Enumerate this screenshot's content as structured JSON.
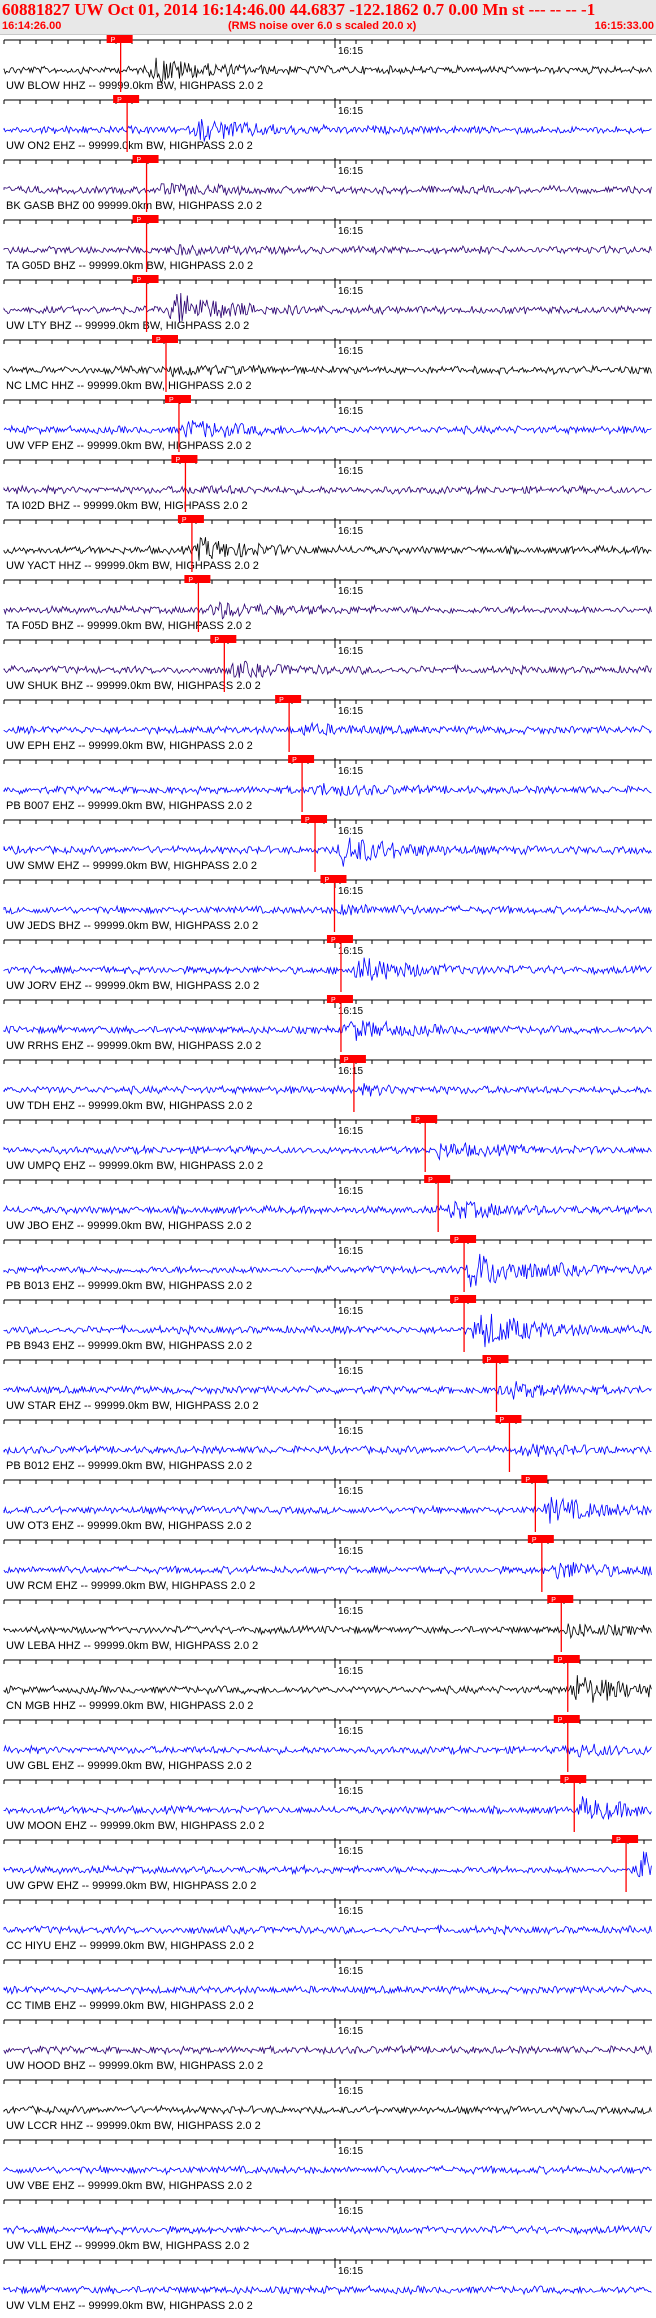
{
  "header": {
    "title": "60881827 UW Oct 01, 2014 16:14:46.00   44.6837 -122.1862  0.7 0.00 Mn st --- -- --  -1",
    "start_time": "16:14:26.00",
    "rms_note": "(RMS noise over 6.0 s scaled 20.0 x)",
    "end_time": "16:15:33.00"
  },
  "colors": {
    "axis": "#000000",
    "trace_blue": "#0000ff",
    "trace_black": "#000000",
    "trace_purple": "#2a0070",
    "pick_marker": "#ff0000",
    "header_text": "#ff0000"
  },
  "minute_tick_label": "16:15",
  "pick_label": "P",
  "stations": [
    {
      "label": "UW BLOW HHZ -- 99999.0km BW, HIGHPASS  2.0  2",
      "color": "black",
      "pick": 0.18,
      "event": 0.23,
      "amp": 0.6
    },
    {
      "label": "UW ON2 EHZ -- 99999.0km BW, HIGHPASS  2.0  2",
      "color": "blue",
      "pick": 0.19,
      "event": 0.3,
      "amp": 0.5
    },
    {
      "label": "BK GASB BHZ 00 99999.0km BW, HIGHPASS  2.0  2",
      "color": "purple",
      "pick": 0.22,
      "event": 0.24,
      "amp": 0.2
    },
    {
      "label": "TA G05D BHZ -- 99999.0km BW, HIGHPASS  2.0  2",
      "color": "purple",
      "pick": 0.22,
      "event": 0.26,
      "amp": 0.15
    },
    {
      "label": "UW LTY BHZ -- 99999.0km BW, HIGHPASS  2.0  2",
      "color": "purple",
      "pick": 0.22,
      "event": 0.26,
      "amp": 0.8
    },
    {
      "label": "NC LMC HHZ -- 99999.0km BW, HIGHPASS  2.0  2",
      "color": "black",
      "pick": 0.25,
      "event": 0.26,
      "amp": 0.2
    },
    {
      "label": "UW VFP EHZ -- 99999.0km BW, HIGHPASS  2.0  2",
      "color": "blue",
      "pick": 0.27,
      "event": 0.28,
      "amp": 0.4
    },
    {
      "label": "TA I02D BHZ -- 99999.0km BW, HIGHPASS  2.0  2",
      "color": "purple",
      "pick": 0.28,
      "event": 0.29,
      "amp": 0.1
    },
    {
      "label": "UW YACT HHZ -- 99999.0km BW, HIGHPASS  2.0  2",
      "color": "black",
      "pick": 0.29,
      "event": 0.3,
      "amp": 0.5
    },
    {
      "label": "TA F05D BHZ -- 99999.0km BW, HIGHPASS  2.0  2",
      "color": "purple",
      "pick": 0.3,
      "event": 0.32,
      "amp": 0.35
    },
    {
      "label": "UW SHUK BHZ -- 99999.0km BW, HIGHPASS  2.0  2",
      "color": "purple",
      "pick": 0.34,
      "event": 0.35,
      "amp": 0.3
    },
    {
      "label": "UW EPH EHZ -- 99999.0km BW, HIGHPASS  2.0  2",
      "color": "blue",
      "pick": 0.44,
      "event": 0.46,
      "amp": 0.2
    },
    {
      "label": "PB B007 EHZ -- 99999.0km BW, HIGHPASS  2.0  2",
      "color": "blue",
      "pick": 0.46,
      "event": 0.48,
      "amp": 0.25
    },
    {
      "label": "UW SMW EHZ -- 99999.0km BW, HIGHPASS  2.0  2",
      "color": "blue",
      "pick": 0.48,
      "event": 0.52,
      "amp": 0.7
    },
    {
      "label": "UW JEDS BHZ -- 99999.0km BW, HIGHPASS  2.0  2",
      "color": "blue",
      "pick": 0.51,
      "event": 0.52,
      "amp": 0.2
    },
    {
      "label": "UW JORV EHZ -- 99999.0km BW, HIGHPASS  2.0  2",
      "color": "blue",
      "pick": 0.52,
      "event": 0.54,
      "amp": 0.6
    },
    {
      "label": "UW RRHS EHZ -- 99999.0km BW, HIGHPASS  2.0  2",
      "color": "blue",
      "pick": 0.52,
      "event": 0.53,
      "amp": 0.45
    },
    {
      "label": "UW TDH EHZ -- 99999.0km BW, HIGHPASS  2.0  2",
      "color": "blue",
      "pick": 0.54,
      "event": 0.55,
      "amp": 0.15
    },
    {
      "label": "UW UMPQ EHZ -- 99999.0km BW, HIGHPASS  2.0  2",
      "color": "blue",
      "pick": 0.65,
      "event": 0.67,
      "amp": 0.3
    },
    {
      "label": "UW JBO EHZ -- 99999.0km BW, HIGHPASS  2.0  2",
      "color": "blue",
      "pick": 0.67,
      "event": 0.69,
      "amp": 0.4
    },
    {
      "label": "PB B013 EHZ -- 99999.0km BW, HIGHPASS  2.0  2",
      "color": "blue",
      "pick": 0.71,
      "event": 0.72,
      "amp": 0.9
    },
    {
      "label": "PB B943 EHZ -- 99999.0km BW, HIGHPASS  2.0  2",
      "color": "blue",
      "pick": 0.71,
      "event": 0.73,
      "amp": 0.9
    },
    {
      "label": "UW STAR EHZ -- 99999.0km BW, HIGHPASS  2.0  2",
      "color": "blue",
      "pick": 0.76,
      "event": 0.77,
      "amp": 0.35
    },
    {
      "label": "PB B012 EHZ -- 99999.0km BW, HIGHPASS  2.0  2",
      "color": "blue",
      "pick": 0.78,
      "event": 0.8,
      "amp": 0.2
    },
    {
      "label": "UW OT3 EHZ -- 99999.0km BW, HIGHPASS  2.0  2",
      "color": "blue",
      "pick": 0.82,
      "event": 0.84,
      "amp": 0.55
    },
    {
      "label": "UW RCM EHZ -- 99999.0km BW, HIGHPASS  2.0  2",
      "color": "blue",
      "pick": 0.83,
      "event": 0.85,
      "amp": 0.4
    },
    {
      "label": "UW LEBA HHZ -- 99999.0km BW, HIGHPASS  2.0  2",
      "color": "black",
      "pick": 0.86,
      "event": 0.87,
      "amp": 0.25
    },
    {
      "label": "CN MGB HHZ -- 99999.0km BW, HIGHPASS  2.0  2",
      "color": "black",
      "pick": 0.87,
      "event": 0.88,
      "amp": 0.7
    },
    {
      "label": "UW GBL EHZ -- 99999.0km BW, HIGHPASS  2.0  2",
      "color": "blue",
      "pick": 0.87,
      "event": 0.88,
      "amp": 0.25
    },
    {
      "label": "UW MOON EHZ -- 99999.0km BW, HIGHPASS  2.0  2",
      "color": "blue",
      "pick": 0.88,
      "event": 0.89,
      "amp": 0.5
    },
    {
      "label": "UW GPW EHZ -- 99999.0km BW, HIGHPASS  2.0  2",
      "color": "blue",
      "pick": 0.96,
      "event": 0.98,
      "amp": 0.8
    },
    {
      "label": "CC HIYU EHZ -- 99999.0km BW, HIGHPASS  2.0  2",
      "color": "blue",
      "pick": null,
      "event": null,
      "amp": 0.1
    },
    {
      "label": "CC TIMB EHZ -- 99999.0km BW, HIGHPASS  2.0  2",
      "color": "blue",
      "pick": null,
      "event": null,
      "amp": 0.1
    },
    {
      "label": "UW HOOD BHZ -- 99999.0km BW, HIGHPASS  2.0  2",
      "color": "purple",
      "pick": null,
      "event": null,
      "amp": 0.1
    },
    {
      "label": "UW LCCR HHZ -- 99999.0km BW, HIGHPASS  2.0  2",
      "color": "black",
      "pick": null,
      "event": null,
      "amp": 0.1
    },
    {
      "label": "UW VBE EHZ -- 99999.0km BW, HIGHPASS  2.0  2",
      "color": "blue",
      "pick": null,
      "event": null,
      "amp": 0.1
    },
    {
      "label": "UW VLL EHZ -- 99999.0km BW, HIGHPASS  2.0  2",
      "color": "blue",
      "pick": null,
      "event": null,
      "amp": 0.1
    },
    {
      "label": "UW VLM EHZ -- 99999.0km BW, HIGHPASS  2.0  2",
      "color": "blue",
      "pick": null,
      "event": null,
      "amp": 0.1
    }
  ]
}
